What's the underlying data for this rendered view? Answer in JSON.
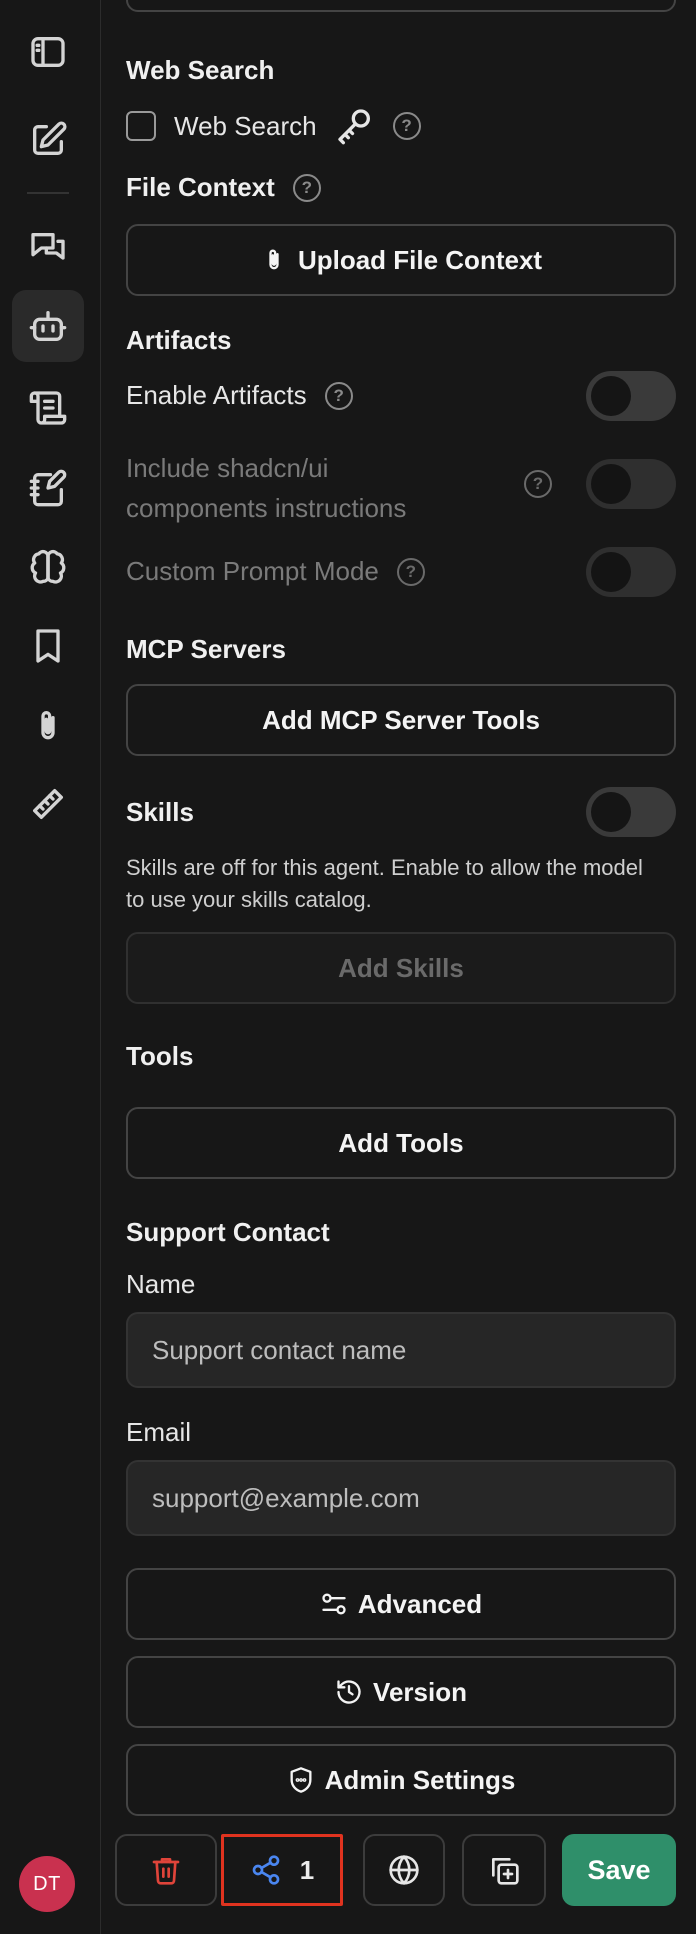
{
  "web_search": {
    "title": "Web Search",
    "checkbox_label": "Web Search"
  },
  "file_context": {
    "title": "File Context",
    "upload_label": "Upload File Context"
  },
  "artifacts": {
    "title": "Artifacts",
    "enable_label": "Enable Artifacts",
    "shadcn_line1": "Include shadcn/ui",
    "shadcn_line2": "components instructions",
    "custom_prompt_label": "Custom Prompt Mode"
  },
  "mcp": {
    "title": "MCP Servers",
    "add_label": "Add MCP Server Tools"
  },
  "skills": {
    "title": "Skills",
    "description": "Skills are off for this agent. Enable to allow the model to use your skills catalog.",
    "add_label": "Add Skills"
  },
  "tools": {
    "title": "Tools",
    "add_label": "Add Tools"
  },
  "support": {
    "title": "Support Contact",
    "name_label": "Name",
    "name_placeholder": "Support contact name",
    "email_label": "Email",
    "email_placeholder": "support@example.com"
  },
  "actions": {
    "advanced_label": "Advanced",
    "version_label": "Version",
    "admin_label": "Admin Settings"
  },
  "bottom": {
    "share_count": "1",
    "save_label": "Save"
  },
  "user": {
    "initials": "DT"
  },
  "colors": {
    "save_bg": "#2f8f6a",
    "share_icon": "#4a86f0",
    "delete_icon": "#e0443a",
    "avatar_bg": "#c9314f",
    "highlight_border": "#e0331f"
  }
}
